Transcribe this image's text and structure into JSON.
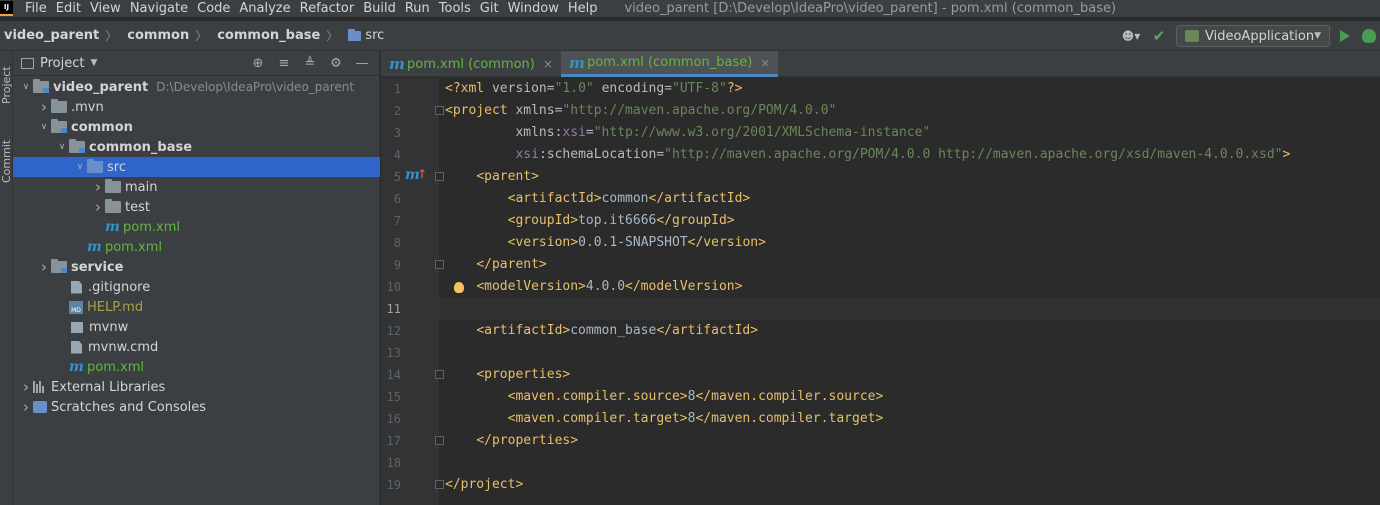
{
  "menubar": {
    "logo": "IJ",
    "items": [
      "File",
      "Edit",
      "View",
      "Navigate",
      "Code",
      "Analyze",
      "Refactor",
      "Build",
      "Run",
      "Tools",
      "Git",
      "Window",
      "Help"
    ],
    "window_title": "video_parent [D:\\Develop\\IdeaPro\\video_parent] - pom.xml (common_base)"
  },
  "breadcrumb": [
    "video_parent",
    "common",
    "common_base",
    "src"
  ],
  "toolbar": {
    "run_config": "VideoApplication",
    "user_icon": "user-icon",
    "build_icon": "hammer-icon",
    "run_icon": "run-icon",
    "debug_icon": "debug-icon"
  },
  "side_tabs": [
    "Project",
    "Commit"
  ],
  "project_panel": {
    "title": "Project",
    "tree": [
      {
        "label": "video_parent",
        "path": "D:\\Develop\\IdeaPro\\video_parent",
        "icon": "module-folder",
        "arrow": "down",
        "indent": 0,
        "style": "bold"
      },
      {
        "label": ".mvn",
        "icon": "folder",
        "arrow": "right",
        "indent": 1,
        "style": "normal"
      },
      {
        "label": "common",
        "icon": "module-folder",
        "arrow": "down",
        "indent": 1,
        "style": "bold"
      },
      {
        "label": "common_base",
        "icon": "module-folder",
        "arrow": "down",
        "indent": 2,
        "style": "bold"
      },
      {
        "label": "src",
        "icon": "src-folder",
        "arrow": "down",
        "indent": 3,
        "style": "normal",
        "selected": true
      },
      {
        "label": "main",
        "icon": "folder",
        "arrow": "right",
        "indent": 4,
        "style": "normal"
      },
      {
        "label": "test",
        "icon": "folder",
        "arrow": "right",
        "indent": 4,
        "style": "normal"
      },
      {
        "label": "pom.xml",
        "icon": "maven",
        "arrow": "none",
        "indent": 4,
        "style": "green"
      },
      {
        "label": "pom.xml",
        "icon": "maven",
        "arrow": "none",
        "indent": 3,
        "style": "green"
      },
      {
        "label": "service",
        "icon": "module-folder",
        "arrow": "right",
        "indent": 1,
        "style": "bold"
      },
      {
        "label": ".gitignore",
        "icon": "doc",
        "arrow": "none",
        "indent": 2,
        "style": "normal"
      },
      {
        "label": "HELP.md",
        "icon": "md",
        "arrow": "none",
        "indent": 2,
        "style": "yellow"
      },
      {
        "label": "mvnw",
        "icon": "terminal",
        "arrow": "none",
        "indent": 2,
        "style": "normal"
      },
      {
        "label": "mvnw.cmd",
        "icon": "doc",
        "arrow": "none",
        "indent": 2,
        "style": "normal"
      },
      {
        "label": "pom.xml",
        "icon": "maven",
        "arrow": "none",
        "indent": 2,
        "style": "green"
      },
      {
        "label": "External Libraries",
        "icon": "library",
        "arrow": "right",
        "indent": 0,
        "style": "normal"
      },
      {
        "label": "Scratches and Consoles",
        "icon": "scratch",
        "arrow": "right",
        "indent": 0,
        "style": "normal"
      }
    ]
  },
  "editor": {
    "tabs": [
      {
        "label": "pom.xml (common)",
        "active": false
      },
      {
        "label": "pom.xml (common_base)",
        "active": true
      }
    ],
    "current_line": 11,
    "lines": [
      {
        "n": "1",
        "tokens": [
          [
            "tg",
            "<?xml "
          ],
          [
            "at",
            "version"
          ],
          [
            "tx",
            "="
          ],
          [
            "av",
            "\"1.0\""
          ],
          [
            "tx",
            " "
          ],
          [
            "at",
            "encoding"
          ],
          [
            "tx",
            "="
          ],
          [
            "av",
            "\"UTF-8\""
          ],
          [
            "tg",
            "?>"
          ]
        ]
      },
      {
        "n": "2",
        "tokens": [
          [
            "tg",
            "<project "
          ],
          [
            "at",
            "xmlns"
          ],
          [
            "tx",
            "="
          ],
          [
            "av",
            "\"http://maven.apache.org/POM/4.0.0\""
          ]
        ]
      },
      {
        "n": "3",
        "tokens": [
          [
            "tx",
            "         "
          ],
          [
            "at",
            "xmlns:"
          ],
          [
            "ns",
            "xsi"
          ],
          [
            "tx",
            "="
          ],
          [
            "av",
            "\"http://www.w3.org/2001/XMLSchema-instance\""
          ]
        ]
      },
      {
        "n": "4",
        "tokens": [
          [
            "tx",
            "         "
          ],
          [
            "ns",
            "xsi"
          ],
          [
            "at",
            ":schemaLocation"
          ],
          [
            "tx",
            "="
          ],
          [
            "av",
            "\"http://maven.apache.org/POM/4.0.0 http://maven.apache.org/xsd/maven-4.0.0.xsd\""
          ],
          [
            "tg",
            ">"
          ]
        ]
      },
      {
        "n": "5",
        "tokens": [
          [
            "tx",
            "    "
          ],
          [
            "tg",
            "<parent>"
          ]
        ]
      },
      {
        "n": "6",
        "tokens": [
          [
            "tx",
            "        "
          ],
          [
            "tg",
            "<artifactId>"
          ],
          [
            "tx",
            "common"
          ],
          [
            "tg",
            "</artifactId>"
          ]
        ]
      },
      {
        "n": "7",
        "tokens": [
          [
            "tx",
            "        "
          ],
          [
            "tg",
            "<groupId>"
          ],
          [
            "tx",
            "top.it6666"
          ],
          [
            "tg",
            "</groupId>"
          ]
        ]
      },
      {
        "n": "8",
        "tokens": [
          [
            "tx",
            "        "
          ],
          [
            "tg",
            "<version>"
          ],
          [
            "tx",
            "0.0.1-SNAPSHOT"
          ],
          [
            "tg",
            "</version>"
          ]
        ]
      },
      {
        "n": "9",
        "tokens": [
          [
            "tx",
            "    "
          ],
          [
            "tg",
            "</parent>"
          ]
        ]
      },
      {
        "n": "10",
        "tokens": [
          [
            "tx",
            "    "
          ],
          [
            "tg",
            "<modelVersion>"
          ],
          [
            "tx",
            "4.0.0"
          ],
          [
            "tg",
            "</modelVersion>"
          ]
        ]
      },
      {
        "n": "11",
        "tokens": []
      },
      {
        "n": "12",
        "tokens": [
          [
            "tx",
            "    "
          ],
          [
            "tg",
            "<artifactId>"
          ],
          [
            "tx",
            "common_base"
          ],
          [
            "tg",
            "</artifactId>"
          ]
        ]
      },
      {
        "n": "13",
        "tokens": []
      },
      {
        "n": "14",
        "tokens": [
          [
            "tx",
            "    "
          ],
          [
            "tg",
            "<properties>"
          ]
        ]
      },
      {
        "n": "15",
        "tokens": [
          [
            "tx",
            "        "
          ],
          [
            "tg",
            "<maven.compiler.source>"
          ],
          [
            "tx",
            "8"
          ],
          [
            "tg",
            "</maven.compiler.source>"
          ]
        ]
      },
      {
        "n": "16",
        "tokens": [
          [
            "tx",
            "        "
          ],
          [
            "tg",
            "<maven.compiler.target>"
          ],
          [
            "tx",
            "8"
          ],
          [
            "tg",
            "</maven.compiler.target>"
          ]
        ]
      },
      {
        "n": "17",
        "tokens": [
          [
            "tx",
            "    "
          ],
          [
            "tg",
            "</properties>"
          ]
        ]
      },
      {
        "n": "18",
        "tokens": []
      },
      {
        "n": "19",
        "tokens": [
          [
            "tg",
            "</project>"
          ]
        ]
      }
    ]
  }
}
